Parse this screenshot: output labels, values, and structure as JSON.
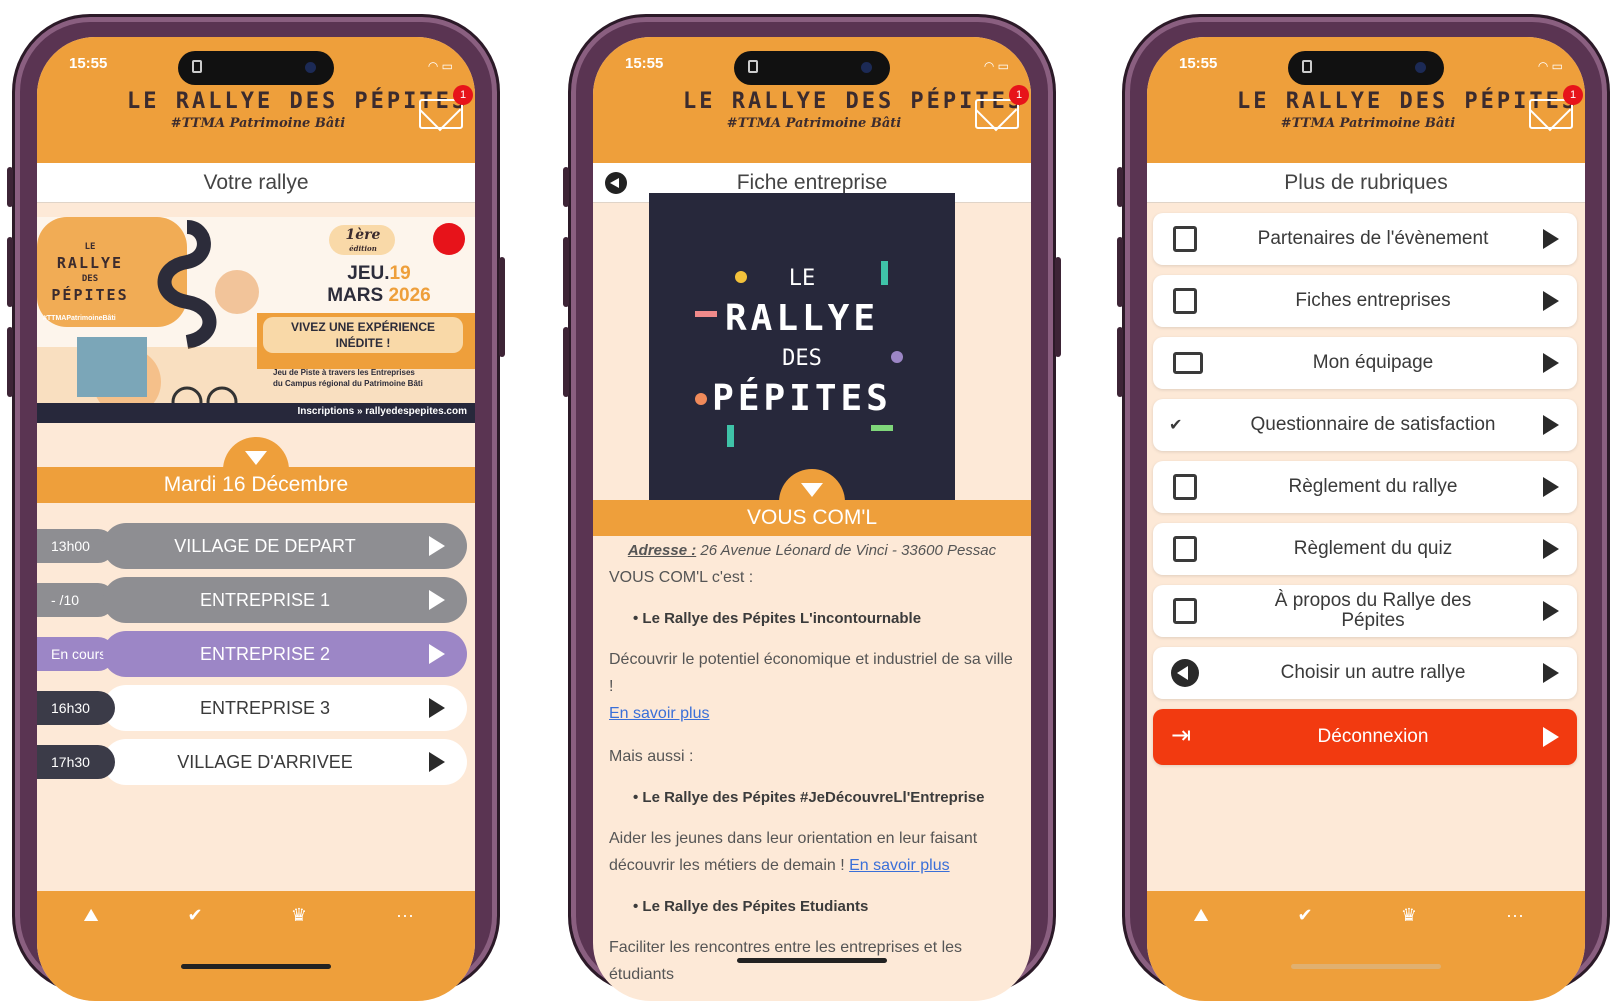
{
  "status": {
    "time": "15:55",
    "badge_count": "1"
  },
  "logo": {
    "line1": "LE RALLYE DES PÉPITES",
    "line2": "#TTMA Patrimoine Bâti"
  },
  "p1": {
    "subtitle": "Votre rallye",
    "banner": {
      "title_small": "LE",
      "title1": "RALLYE",
      "title2": "DES",
      "title3": "PÉPITES",
      "edition": "1ère",
      "edition_sub": "édition",
      "date_day": "JEU.",
      "date_num": "19",
      "date_month": "MARS",
      "date_year": "2026",
      "tagline1": "VIVEZ UNE EXPÉRIENCE",
      "tagline2": "INÉDITE !",
      "desc1": "Jeu de Piste à travers les Entreprises",
      "desc2": "du Campus régional du Patrimoine Bâti",
      "hashtag": "#TTMAPatrimoineBâti",
      "inscription": "Inscriptions » rallyedespepites.com"
    },
    "date": "Mardi 16 Décembre",
    "rows": [
      {
        "time": "13h00",
        "label": "VILLAGE DE DEPART"
      },
      {
        "time": "- /10",
        "label": "ENTREPRISE 1"
      },
      {
        "time": "En cours",
        "label": "ENTREPRISE 2"
      },
      {
        "time": "16h30",
        "label": "ENTREPRISE 3"
      },
      {
        "time": "17h30",
        "label": "VILLAGE D'ARRIVEE"
      }
    ]
  },
  "p2": {
    "subtitle": "Fiche entreprise",
    "logo_le": "LE",
    "logo_rallye": "RALLYE",
    "logo_des": "DES",
    "logo_pepites": "PÉPITES",
    "company": "VOUS COM'L",
    "address_label": "Adresse :",
    "address": "26 Avenue Léonard de Vinci - 33600 Pessac",
    "intro": "VOUS COM'L c'est :",
    "b1": "Le Rallye des Pépites L'incontournable",
    "p1": "Découvrir le potentiel économique et industriel de sa ville !",
    "link1": "En savoir plus",
    "also": "Mais aussi :",
    "b2": "Le Rallye des Pépites #JeDécouvreLl'Entreprise",
    "p2": "Aider les jeunes dans leur orientation en leur faisant découvrir les métiers de demain !",
    "link2": "En savoir plus",
    "b3": "Le Rallye des Pépites Etudiants",
    "p3": "Faciliter les rencontres entre les entreprises et les étudiants"
  },
  "p3": {
    "subtitle": "Plus de rubriques",
    "items": [
      {
        "label": "Partenaires de l'évènement"
      },
      {
        "label": "Fiches entreprises"
      },
      {
        "label": "Mon équipage"
      },
      {
        "label": "Questionnaire de satisfaction"
      },
      {
        "label": "Règlement du rallye"
      },
      {
        "label": "Règlement du quiz"
      },
      {
        "label": "À propos du Rallye des Pépites"
      },
      {
        "label": "Choisir un autre rallye"
      },
      {
        "label": "Déconnexion"
      }
    ]
  },
  "tabs": {
    "more": "···"
  },
  "colors": {
    "orange": "#ee9f3b",
    "cream": "#fde9d7",
    "grey_pill": "#8e8e92",
    "purple_pill": "#9c86c6",
    "red": "#f23a10",
    "dark": "#27283b"
  }
}
